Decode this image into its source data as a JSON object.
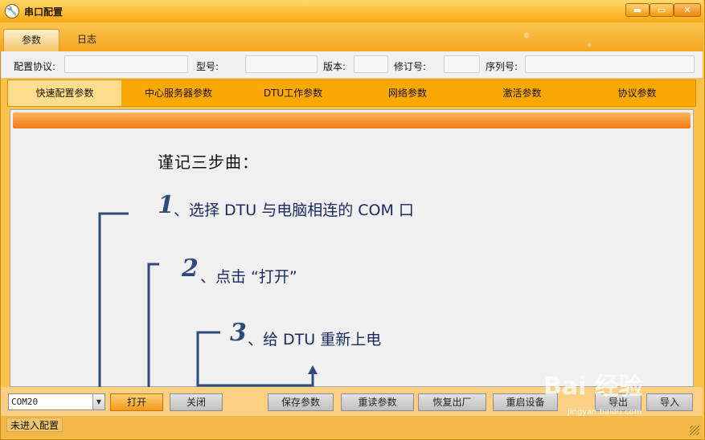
{
  "window": {
    "title": "串口配置",
    "buttons": {
      "minimize": "▬",
      "maximize": "▭",
      "close": "✕"
    }
  },
  "tabs": [
    {
      "label": "参数"
    },
    {
      "label": "日志"
    }
  ],
  "info": {
    "protocol": "配置协议:",
    "model": "型号:",
    "version": "版本:",
    "revision": "修订号:",
    "serial": "序列号:"
  },
  "subtabs": [
    "快速配置参数",
    "中心服务器参数",
    "DTU工作参数",
    "网络参数",
    "激活参数",
    "协议参数"
  ],
  "steps": {
    "title": "谨记三步曲：",
    "items": [
      {
        "num": "1",
        "text": "、选择 DTU 与电脑相连的 COM 口"
      },
      {
        "num": "2",
        "text": "、点击 “打开”"
      },
      {
        "num": "3",
        "text": "、给 DTU 重新上电"
      }
    ]
  },
  "controls": {
    "port": "COM20",
    "open": "打开",
    "close": "关闭",
    "save": "保存参数",
    "reload": "重读参数",
    "restore": "恢复出厂",
    "restart": "重启设备",
    "export": "导出",
    "import": "导入"
  },
  "status": "未进入配置",
  "watermark": {
    "main": "Bai 经验",
    "sub": "jingyan.baidu.com"
  },
  "colors": {
    "accent": "#f8a800",
    "annotation": "#2e4a7a"
  }
}
